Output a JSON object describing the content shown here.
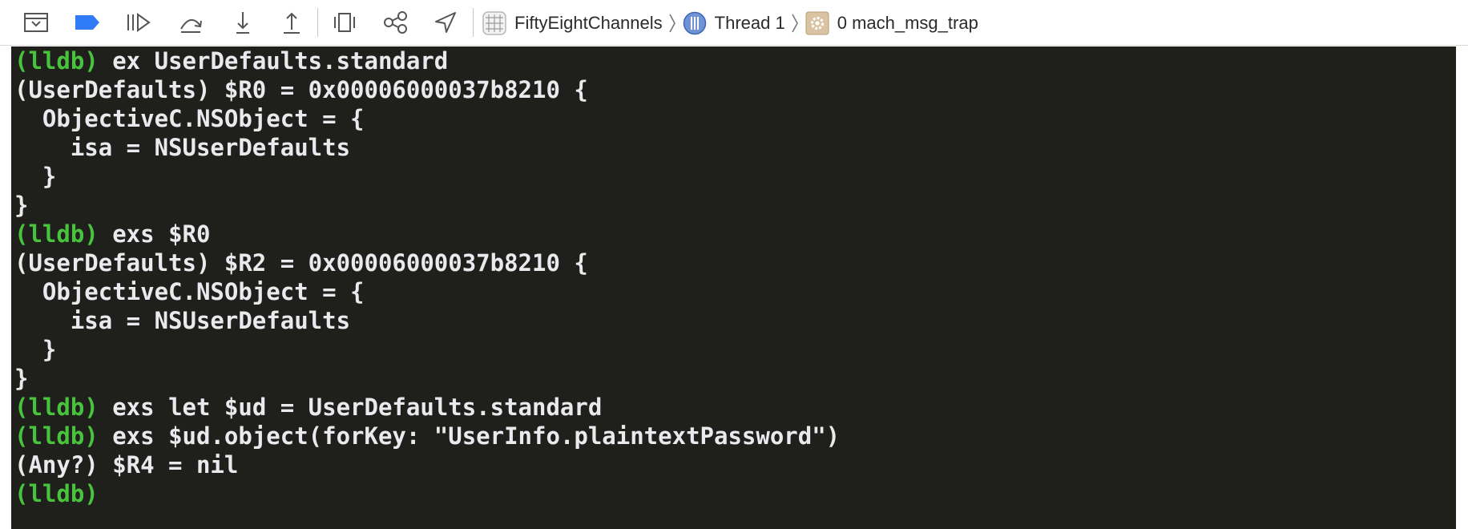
{
  "toolbar": {
    "items": [
      {
        "name": "hide-debug-area",
        "icon": "hide-debug-area-icon"
      },
      {
        "name": "breakpoints-toggle",
        "icon": "breakpoint-icon",
        "color": "#2f7cf6"
      },
      {
        "name": "continue",
        "icon": "continue-icon"
      },
      {
        "name": "step-over",
        "icon": "step-over-icon"
      },
      {
        "name": "step-into",
        "icon": "step-into-icon"
      },
      {
        "name": "step-out",
        "icon": "step-out-icon"
      },
      {
        "name": "view-hierarchy",
        "icon": "view-hierarchy-icon"
      },
      {
        "name": "memory-graph",
        "icon": "memory-graph-icon"
      },
      {
        "name": "simulate-location",
        "icon": "location-arrow-icon"
      }
    ]
  },
  "breadcrumbs": {
    "app": "FiftyEightChannels",
    "thread": "Thread 1",
    "frame": "0 mach_msg_trap"
  },
  "console": {
    "prompt_color": "#49c33e",
    "text_color": "#e9e9ee",
    "background": "#1f201c",
    "lines": [
      {
        "prompt": "(lldb)",
        "text": " ex UserDefaults.standard"
      },
      {
        "prompt": "",
        "text": "(UserDefaults) $R0 = 0x00006000037b8210 {"
      },
      {
        "prompt": "",
        "text": "  ObjectiveC.NSObject = {"
      },
      {
        "prompt": "",
        "text": "    isa = NSUserDefaults"
      },
      {
        "prompt": "",
        "text": "  }"
      },
      {
        "prompt": "",
        "text": "}"
      },
      {
        "prompt": "(lldb)",
        "text": " exs $R0"
      },
      {
        "prompt": "",
        "text": "(UserDefaults) $R2 = 0x00006000037b8210 {"
      },
      {
        "prompt": "",
        "text": "  ObjectiveC.NSObject = {"
      },
      {
        "prompt": "",
        "text": "    isa = NSUserDefaults"
      },
      {
        "prompt": "",
        "text": "  }"
      },
      {
        "prompt": "",
        "text": "}"
      },
      {
        "prompt": "(lldb)",
        "text": " exs let $ud = UserDefaults.standard"
      },
      {
        "prompt": "(lldb)",
        "text": " exs $ud.object(forKey: \"UserInfo.plaintextPassword\")"
      },
      {
        "prompt": "",
        "text": "(Any?) $R4 = nil"
      },
      {
        "prompt": "(lldb)",
        "text": ""
      }
    ]
  }
}
